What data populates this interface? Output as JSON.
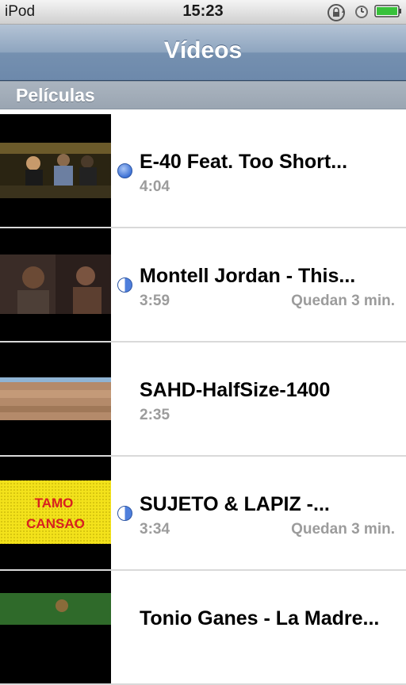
{
  "status": {
    "carrier": "iPod",
    "time": "15:23"
  },
  "nav": {
    "title": "Vídeos"
  },
  "section": {
    "label": "Películas"
  },
  "videos": [
    {
      "title": "E-40 Feat. Too Short...",
      "duration": "4:04",
      "remaining": "",
      "progress": "unwatched"
    },
    {
      "title": "Montell Jordan - This...",
      "duration": "3:59",
      "remaining": "Quedan 3 min.",
      "progress": "partially-watched"
    },
    {
      "title": "SAHD-HalfSize-1400",
      "duration": "2:35",
      "remaining": "",
      "progress": "watched"
    },
    {
      "title": "SUJETO & LAPIZ -...",
      "duration": "3:34",
      "remaining": "Quedan 3 min.",
      "progress": "partially-watched"
    },
    {
      "title": "Tonio Ganes - La Madre...",
      "duration": "",
      "remaining": "",
      "progress": "unknown"
    }
  ],
  "thumb_text": {
    "tamo": "TAMO",
    "cansao": "CANSAO"
  },
  "colors": {
    "accent_blue": "#3f73d6",
    "nav_bar": "#8ea5bf",
    "secondary_text": "#9c9c9c"
  },
  "icons": [
    "rotation-lock-icon",
    "alarm-clock-icon",
    "battery-icon",
    "unwatched-dot-icon",
    "half-watched-icon"
  ]
}
